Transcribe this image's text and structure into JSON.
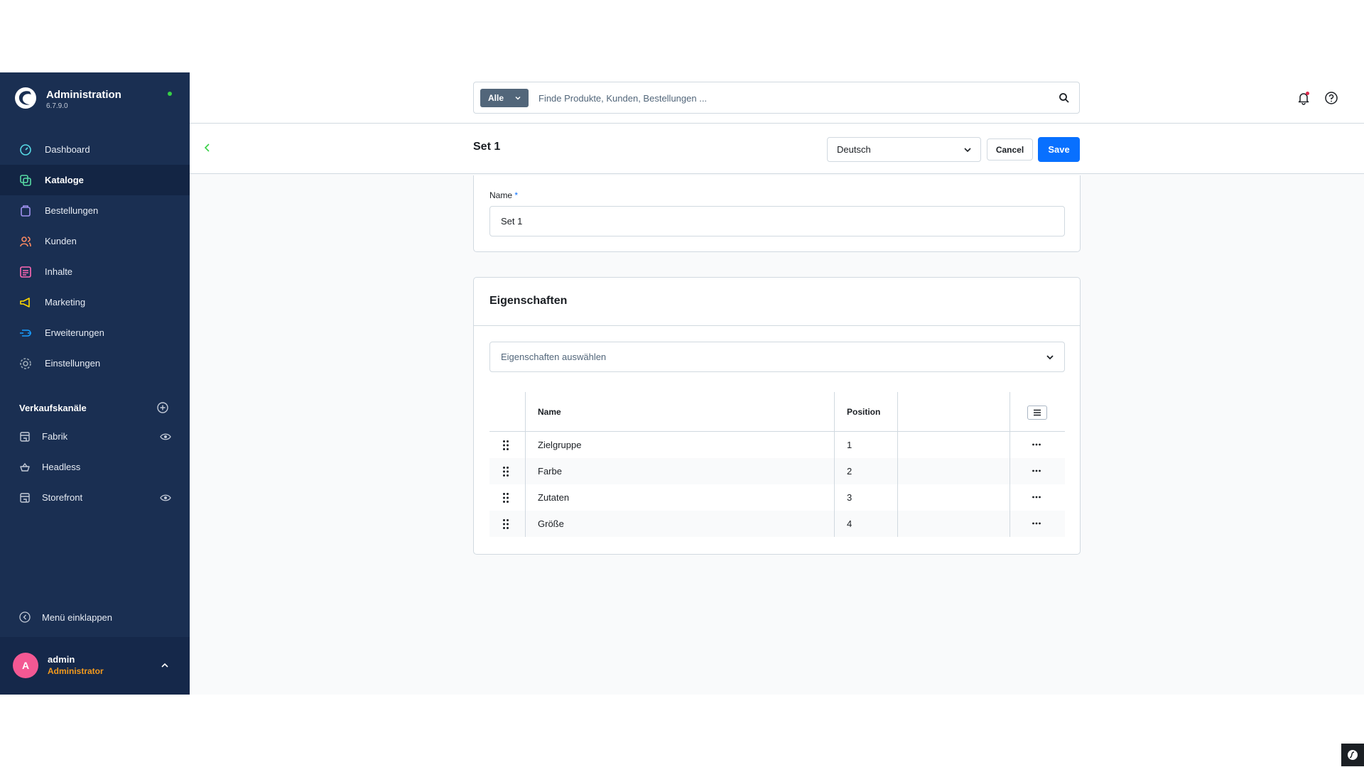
{
  "sidebar": {
    "brand": {
      "title": "Administration",
      "version": "6.7.9.0"
    },
    "nav": [
      {
        "label": "Dashboard",
        "icon": "dashboard-icon",
        "color": "#57d9e5"
      },
      {
        "label": "Kataloge",
        "icon": "catalog-icon",
        "color": "#57d9a3"
      },
      {
        "label": "Bestellungen",
        "icon": "orders-icon",
        "color": "#a092f0"
      },
      {
        "label": "Kunden",
        "icon": "customers-icon",
        "color": "#f88962"
      },
      {
        "label": "Inhalte",
        "icon": "content-icon",
        "color": "#ff68b4"
      },
      {
        "label": "Marketing",
        "icon": "marketing-icon",
        "color": "#ffd700"
      },
      {
        "label": "Erweiterungen",
        "icon": "extensions-icon",
        "color": "#189eff"
      },
      {
        "label": "Einstellungen",
        "icon": "settings-icon",
        "color": "#9aa8b5"
      }
    ],
    "sales_channels": {
      "title": "Verkaufskanäle",
      "items": [
        {
          "label": "Fabrik",
          "icon": "storefront-icon",
          "visible_toggle": true
        },
        {
          "label": "Headless",
          "icon": "headless-icon",
          "visible_toggle": false
        },
        {
          "label": "Storefront",
          "icon": "storefront-icon",
          "visible_toggle": true
        }
      ]
    },
    "collapse_label": "Menü einklappen",
    "user": {
      "initial": "A",
      "name": "admin",
      "role": "Administrator"
    }
  },
  "search": {
    "scope": "Alle",
    "placeholder": "Finde Produkte, Kunden, Bestellungen ..."
  },
  "smartbar": {
    "title": "Set 1",
    "language": "Deutsch",
    "cancel_label": "Cancel",
    "save_label": "Save"
  },
  "name_field": {
    "label": "Name",
    "required_mark": "*",
    "value": "Set 1"
  },
  "properties": {
    "title": "Eigenschaften",
    "select_placeholder": "Eigenschaften auswählen",
    "columns": {
      "name": "Name",
      "position": "Position"
    },
    "rows": [
      {
        "name": "Zielgruppe",
        "position": "1"
      },
      {
        "name": "Farbe",
        "position": "2"
      },
      {
        "name": "Zutaten",
        "position": "3"
      },
      {
        "name": "Größe",
        "position": "4"
      }
    ]
  },
  "colors": {
    "sidebar_bg": "#1a2f52",
    "primary": "#0870ff",
    "avatar": "#f35893",
    "role": "#f39a1d",
    "status_online": "#37d046"
  }
}
